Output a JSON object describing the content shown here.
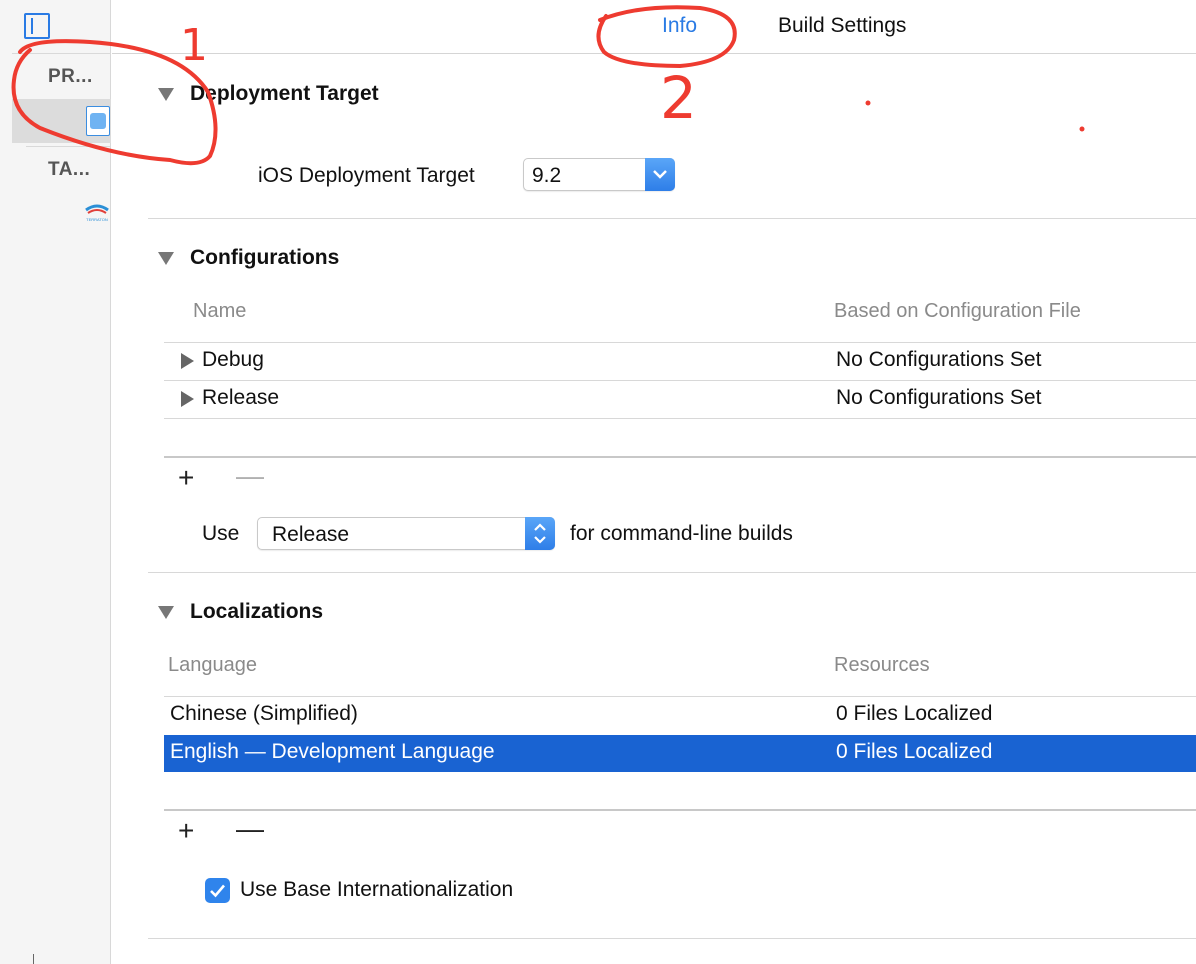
{
  "sidebar": {
    "project_section_label": "PR...",
    "targets_section_label": "TA...",
    "target_icon_text": "TERRATON"
  },
  "tabs": {
    "info_label": "Info",
    "build_settings_label": "Build Settings"
  },
  "annotations": {
    "mark_1": "1",
    "mark_2": "2",
    "color": "#ee3b30"
  },
  "deployment": {
    "title": "Deployment Target",
    "ios_target_label": "iOS Deployment Target",
    "ios_target_value": "9.2"
  },
  "configurations": {
    "title": "Configurations",
    "columns": [
      "Name",
      "Based on Configuration File"
    ],
    "rows": [
      {
        "name": "Debug",
        "file": "No Configurations Set"
      },
      {
        "name": "Release",
        "file": "No Configurations Set"
      }
    ],
    "use_label": "Use",
    "use_value": "Release",
    "use_suffix": "for command-line builds"
  },
  "localizations": {
    "title": "Localizations",
    "columns": [
      "Language",
      "Resources"
    ],
    "rows": [
      {
        "language": "Chinese (Simplified)",
        "resources": "0 Files Localized",
        "selected": false
      },
      {
        "language": "English — Development Language",
        "resources": "0 Files Localized",
        "selected": true
      }
    ],
    "base_intl_label": "Use Base Internationalization",
    "base_intl_checked": true
  },
  "colors": {
    "accent": "#2a7be4",
    "selection": "#1963d2"
  }
}
